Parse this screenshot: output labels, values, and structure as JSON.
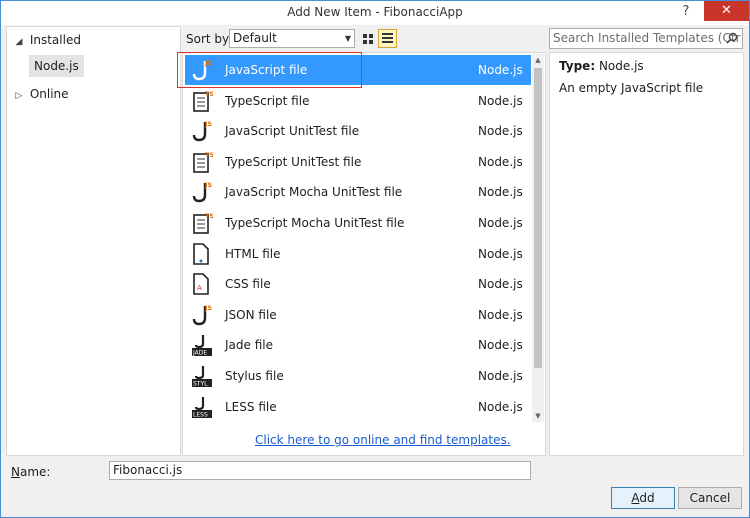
{
  "window": {
    "title": "Add New Item - FibonacciApp",
    "help_label": "?",
    "close_label": "✕"
  },
  "tree": {
    "installed": {
      "label": "Installed",
      "toggle": "◢"
    },
    "nodejs": {
      "label": "Node.js"
    },
    "online": {
      "label": "Online",
      "toggle": "▷"
    }
  },
  "sort": {
    "label": "Sort by:",
    "value": "Default"
  },
  "items": [
    {
      "name": "JavaScript file",
      "type": "Node.js",
      "icon": "js-file-icon",
      "selected": true
    },
    {
      "name": "TypeScript file",
      "type": "Node.js",
      "icon": "ts-file-icon"
    },
    {
      "name": "JavaScript UnitTest file",
      "type": "Node.js",
      "icon": "js-file-icon"
    },
    {
      "name": "TypeScript UnitTest file",
      "type": "Node.js",
      "icon": "ts-file-icon"
    },
    {
      "name": "JavaScript Mocha UnitTest file",
      "type": "Node.js",
      "icon": "js-file-icon"
    },
    {
      "name": "TypeScript Mocha UnitTest file",
      "type": "Node.js",
      "icon": "ts-file-icon"
    },
    {
      "name": "HTML file",
      "type": "Node.js",
      "icon": "html-file-icon"
    },
    {
      "name": "CSS file",
      "type": "Node.js",
      "icon": "css-file-icon"
    },
    {
      "name": "JSON file",
      "type": "Node.js",
      "icon": "json-file-icon"
    },
    {
      "name": "Jade file",
      "type": "Node.js",
      "icon": "jade-file-icon"
    },
    {
      "name": "Stylus file",
      "type": "Node.js",
      "icon": "stylus-file-icon"
    },
    {
      "name": "LESS file",
      "type": "Node.js",
      "icon": "less-file-icon"
    }
  ],
  "online_link": "Click here to go online and find templates.",
  "search": {
    "placeholder": "Search Installed Templates (Ctr"
  },
  "detail": {
    "type_label": "Type:",
    "type_value": "Node.js",
    "description": "An empty JavaScript file"
  },
  "footer": {
    "name_label": "Name:",
    "name_value": "Fibonacci.js",
    "add_label": "Add",
    "cancel_label": "Cancel"
  },
  "colors": {
    "selection": "#3399ff",
    "link": "#1a5dcc",
    "close": "#c7352b",
    "highlight": "#e03030"
  }
}
